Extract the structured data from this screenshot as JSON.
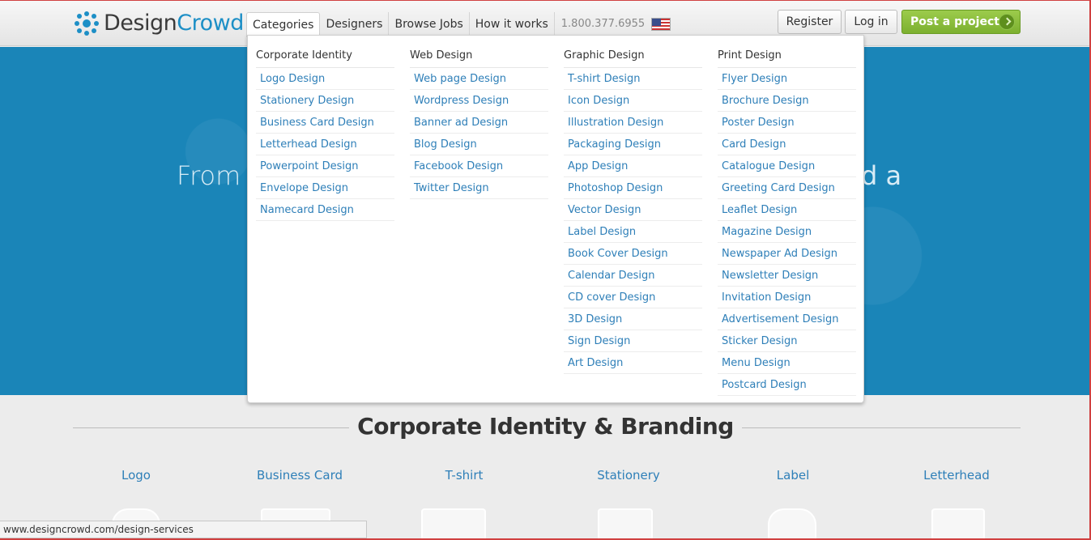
{
  "logo": {
    "part1": "Design",
    "part2": "Crowd"
  },
  "nav": [
    "Categories",
    "Designers",
    "Browse Jobs",
    "How it works"
  ],
  "phone": "1.800.377.6955",
  "buttons": {
    "register": "Register",
    "login": "Log in",
    "post": "Post a project"
  },
  "hero": {
    "left": "From l",
    "right": "d a"
  },
  "dropdown": {
    "columns": [
      {
        "head": "Corporate Identity",
        "items": [
          "Logo Design",
          "Stationery Design",
          "Business Card Design",
          "Letterhead Design",
          "Powerpoint Design",
          "Envelope Design",
          "Namecard Design"
        ]
      },
      {
        "head": "Web Design",
        "items": [
          "Web page Design",
          "Wordpress Design",
          "Banner ad Design",
          "Blog Design",
          "Facebook Design",
          "Twitter Design"
        ]
      },
      {
        "head": "Graphic Design",
        "items": [
          "T-shirt Design",
          "Icon Design",
          "Illustration Design",
          "Packaging Design",
          "App Design",
          "Photoshop Design",
          "Vector Design",
          "Label Design",
          "Book Cover Design",
          "Calendar Design",
          "CD cover Design",
          "3D Design",
          "Sign Design",
          "Art Design"
        ]
      },
      {
        "head": "Print Design",
        "items": [
          "Flyer Design",
          "Brochure Design",
          "Poster Design",
          "Card Design",
          "Catalogue Design",
          "Greeting Card Design",
          "Leaflet Design",
          "Magazine Design",
          "Newspaper Ad Design",
          "Newsletter Design",
          "Invitation Design",
          "Advertisement Design",
          "Sticker Design",
          "Menu Design",
          "Postcard Design"
        ]
      }
    ]
  },
  "section": {
    "title": "Corporate Identity & Branding",
    "categories": [
      "Logo",
      "Business Card",
      "T-shirt",
      "Stationery",
      "Label",
      "Letterhead"
    ]
  },
  "statusbar": "www.designcrowd.com/design-services",
  "colors": {
    "brand_blue": "#1d8fc6",
    "hero_blue": "#1a85b8",
    "link_blue": "#2e7fb8",
    "green": "#7cb030"
  }
}
